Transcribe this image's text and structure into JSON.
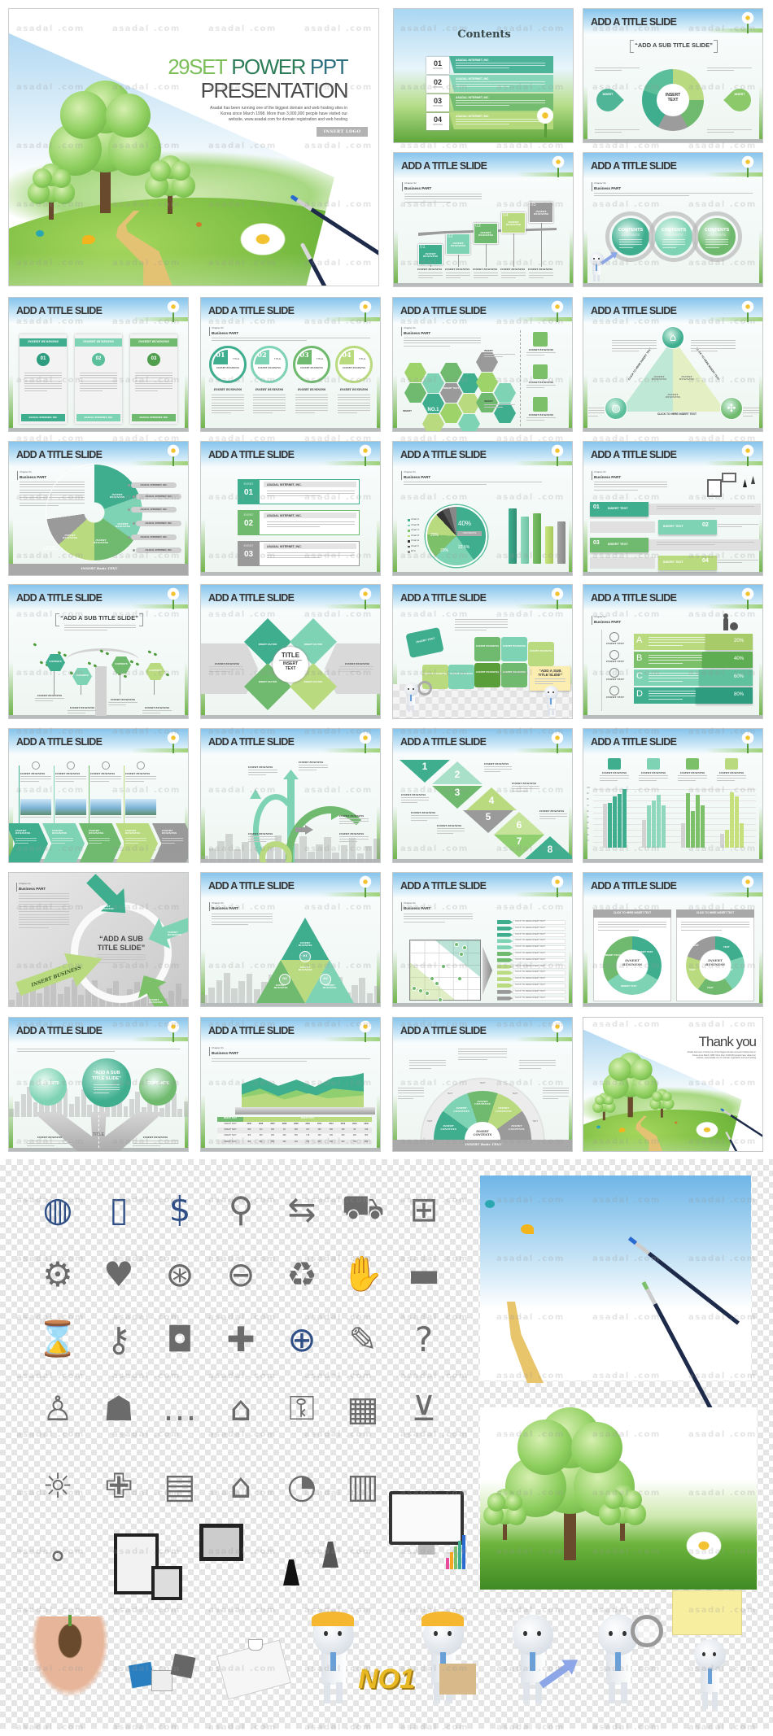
{
  "watermark": "asadal .com",
  "hero": {
    "title_a": "29SET",
    "title_b": "POWER",
    "title_c": "PPT",
    "title_line2": "PRESENTATION",
    "body": [
      "Asadal has been running one of the biggest domain and web hosting sites in",
      "Korea since March 1998.  More than 3,000,000 people have visited our",
      "website,  www.asadal.com for domain registration and web hosting"
    ],
    "logo_button": "INSERT LOGO"
  },
  "common": {
    "chapter": "Chapter 01",
    "business_part": "Business PART"
  },
  "colors": {
    "teal": "#3fae8f",
    "mint": "#7fd3b5",
    "green": "#6fba6e",
    "light_green": "#b9da7f",
    "gray": "#9a9a9a",
    "sky": "#a7d3f1"
  },
  "slides": [
    {
      "title": "Contents",
      "items": [
        {
          "num": "01",
          "sub": "OPTIONS",
          "label": "ASADAL INTERNET, INC"
        },
        {
          "num": "02",
          "sub": "OPTIONS",
          "label": "ASADAL INTERNET, INC"
        },
        {
          "num": "03",
          "sub": "OPTIONS",
          "label": "ASADAL INTERNET, INC"
        },
        {
          "num": "04",
          "sub": "OPTIONS",
          "label": "ASADAL INTERNET, INC"
        }
      ]
    },
    {
      "title": "ADD A TITLE SLIDE",
      "subtitle": "“ADD A SUB TITLE SLIDE”",
      "center": "INSERT TEXT",
      "side": "INSERT"
    },
    {
      "title": "ADD A TITLE SLIDE",
      "steps": [
        "01",
        "02",
        "03",
        "04",
        "05"
      ],
      "step_label": "INSERT BUSINESS"
    },
    {
      "title": "ADD A TITLE SLIDE",
      "circle_title": "CONTENTS",
      "circle_sub": "CONTENTS"
    },
    {
      "title": "ADD A TITLE SLIDE",
      "cards": [
        "01",
        "02",
        "03"
      ],
      "card_head": "INSERT BUSINESS",
      "card_foot": "ASADAL INTERNET, INC."
    },
    {
      "title": "ADD A TITLE SLIDE",
      "circles": [
        "01",
        "02",
        "03",
        "04"
      ],
      "circle_tag": "TITLE",
      "label": "INSERT BUSINESS"
    },
    {
      "title": "ADD A TITLE SLIDE",
      "hex_center": "INSERT TEXT",
      "hex_badge": "NO.1",
      "label": "INSERT",
      "side_label": "INSERT BUSINESS"
    },
    {
      "title": "ADD A TITLE SLIDE",
      "link": "CLICK TO HERE INSERT TEXT",
      "label": "INSERT BUSINESS"
    },
    {
      "title": "ADD A TITLE SLIDE",
      "pill": "ASADAL INTERNET, INC.",
      "label": "INSERT BUSINESS",
      "footer": "INSERT Basic TEXT"
    },
    {
      "title": "ADD A TITLE SLIDE",
      "events": [
        "01",
        "02",
        "03"
      ],
      "event_tag": "EVENT",
      "event_title": "ASADAL INTERNET, INC."
    },
    {
      "title": "ADD A TITLE SLIDE",
      "pie_labels": [
        "40%",
        "22.5%",
        "20%",
        "20%"
      ],
      "pie_tag": "CONTENTS",
      "legend": [
        "Chart A",
        "Chart B",
        "Chart C",
        "Chart D",
        "Chart E",
        "Chart F",
        "ETC"
      ]
    },
    {
      "title": "ADD A TITLE SLIDE",
      "ribbons": [
        "01",
        "02",
        "03",
        "04"
      ],
      "ribbon_label": "INSERT TEXT"
    },
    {
      "title": "ADD A TITLE SLIDE",
      "subtitle": "“ADD A SUB TITLE SLIDE”",
      "hex_label": "CONTENTS",
      "label": "INSERT BUSINESS"
    },
    {
      "title": "ADD A TITLE SLIDE",
      "center_title": "TITLE",
      "center_text": "INSERT TEXT",
      "factor": "INSERT FACTOR",
      "label": "INSERT BUSINESS"
    },
    {
      "title": "ADD A TITLE SLIDE",
      "note_a": "“ADD A SUB",
      "note_b": "TITLE SLIDE”",
      "piece": "INSERT TEXT",
      "piece2": "INSERT BUSINESS"
    },
    {
      "title": "ADD A TITLE SLIDE",
      "steps": [
        "A",
        "B",
        "C",
        "D"
      ],
      "percents": [
        "20%",
        "40%",
        "60%",
        "80%"
      ],
      "label": "INSERT TEXT"
    },
    {
      "title": "ADD A TITLE SLIDE",
      "label": "INSERT BUSINESS"
    },
    {
      "title": "ADD A TITLE SLIDE",
      "label": "INSERT BUSINESS"
    },
    {
      "title": "ADD A TITLE SLIDE",
      "numbers": [
        "1",
        "2",
        "3",
        "4",
        "5",
        "6",
        "7",
        "8"
      ],
      "label": "INSERT BUSINESS"
    },
    {
      "title": "ADD A TITLE SLIDE",
      "label": "INSERT BUSINESS",
      "axis_ticks": [
        "100",
        "90",
        "80",
        "70",
        "60",
        "50",
        "40",
        "30",
        "20",
        "10"
      ],
      "bar_values": [
        [
          75,
          77,
          87,
          92,
          100
        ],
        [
          47,
          72,
          81,
          90,
          72
        ],
        [
          42,
          93,
          62,
          90,
          72
        ],
        [
          23,
          30,
          95,
          87,
          42
        ]
      ]
    },
    {
      "title": "",
      "subtitle_a": "“ADD A SUB",
      "subtitle_b": "TITLE SLIDE”",
      "label": "INSERT BUSINESS"
    },
    {
      "title": "ADD A TITLE SLIDE",
      "label": "INSERT BUSINESS",
      "nums": [
        "01",
        "02",
        "03"
      ]
    },
    {
      "title": "ADD A TITLE SLIDE",
      "list_label": "CLICK TO HERE INSERT TEXT"
    },
    {
      "title": "ADD A TITLE SLIDE",
      "col_head": "CLICK TO HERE INSERT TEXT",
      "center": "INSERT BUSINESS",
      "seg_a": "INSERT TEXT",
      "seg_b": "TEXT"
    },
    {
      "title": "ADD A TITLE SLIDE",
      "circle": "CONTENTS",
      "center_a": "“ADD A SUB",
      "center_b": "TITLE SLIDE”",
      "road": "TITLE",
      "label": "INSERT BUSINESS"
    },
    {
      "title": "ADD A TITLE SLIDE",
      "table_head": [
        "INSERT TEXT",
        "INSERT TEXT"
      ],
      "row_label": "INSERT TEXT",
      "years": [
        "2005",
        "2006",
        "2007",
        "2008",
        "2009",
        "2010",
        "2011",
        "2012",
        "2013",
        "2014",
        "2015"
      ],
      "rows": [
        [
          "250",
          "114",
          "200",
          "20",
          "250",
          "107",
          "250",
          "300",
          "150",
          "50",
          "100"
        ],
        [
          "400",
          "400",
          "200",
          "400",
          "350",
          "178",
          "400",
          "400",
          "400",
          "200",
          "500"
        ],
        [
          "400",
          "500",
          "550",
          "450",
          "400",
          "700",
          "527",
          "650",
          "600",
          "750",
          "900"
        ]
      ]
    },
    {
      "title": "ADD A TITLE SLIDE",
      "seg": "INSERT CONTENTS",
      "arc": "TEXT",
      "footer": "INSERT Basic TEXT"
    },
    {
      "title": "Thank you",
      "body": [
        "Asadal has been running one of the biggest domain and web hosting sites in",
        "Korea since March 1998.  More than 3,000,000 people have visited our",
        "website,  www.asadal.com for domain registration and web hosting"
      ]
    }
  ],
  "assets": {
    "badge": "NO1",
    "icons": [
      [
        "globe-icon",
        "phone-icon",
        "money-bag-icon",
        "location-icon",
        "signpost-icon",
        "truck-icon",
        "basket-icon"
      ],
      [
        "gears-icon",
        "heart-icon",
        "compass-icon",
        "lock-icon",
        "recycle-icon",
        "handshake-icon",
        "car-icon"
      ],
      [
        "hourglass-icon",
        "key-icon",
        "camera-icon",
        "mortar-icon",
        "world-icon",
        "easel-icon",
        "question-chat-icon"
      ],
      [
        "person-money-icon",
        "family-icon",
        "chat-icon",
        "graduation-cap-icon",
        "key-lock-icon",
        "building-icon",
        "cart-icon"
      ],
      [
        "lightbulb-icon",
        "ambulance-icon",
        "shop-icon",
        "house-icon",
        "pie-chart-icon",
        "document-icon"
      ],
      [
        "bubbles-icon"
      ]
    ]
  }
}
